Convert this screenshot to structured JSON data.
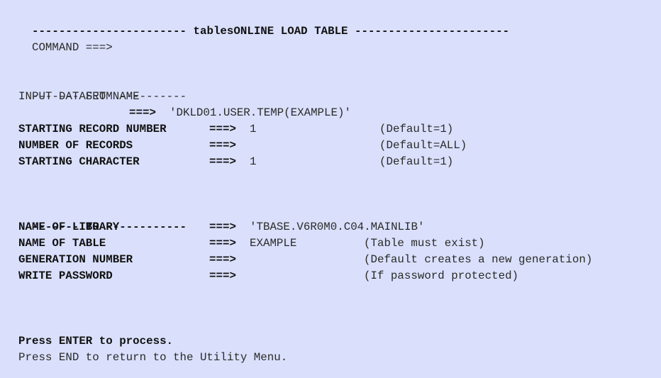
{
  "header": {
    "dashes_left": "-----------------------",
    "title": "tablesONLINE LOAD TABLE",
    "dashes_right": "-----------------------"
  },
  "command": {
    "label": "COMMAND ===>",
    "value": ""
  },
  "from_section": {
    "heading_left": "-------",
    "heading": "FROM",
    "heading_right": "----------",
    "input_dataset_label": "INPUT DATASET NAME",
    "input_dataset_arrow": "===>",
    "input_dataset_value": "'DKLD01.USER.TEMP(EXAMPLE)'",
    "fields": [
      {
        "label": "STARTING RECORD NUMBER",
        "arrow": "===>",
        "value": "1",
        "hint": "(Default=1)"
      },
      {
        "label": "NUMBER OF RECORDS",
        "arrow": "===>",
        "value": "",
        "hint": "(Default=ALL)"
      },
      {
        "label": "STARTING CHARACTER",
        "arrow": "===>",
        "value": "1",
        "hint": "(Default=1)"
      }
    ]
  },
  "to_section": {
    "heading_left": "-------",
    "heading": "TO",
    "heading_right": "------------",
    "fields": [
      {
        "label": "NAME OF LIBRARY",
        "arrow": "===>",
        "value": "'TBASE.V6R0M0.C04.MAINLIB'",
        "hint": ""
      },
      {
        "label": "NAME OF TABLE",
        "arrow": "===>",
        "value": "EXAMPLE",
        "hint": "(Table must exist)"
      },
      {
        "label": "GENERATION NUMBER",
        "arrow": "===>",
        "value": "",
        "hint": "(Default creates a new generation)"
      },
      {
        "label": "WRITE PASSWORD",
        "arrow": "===>",
        "value": "",
        "hint": "(If password protected)"
      }
    ]
  },
  "footer": {
    "enter_hint": "Press ENTER to process.",
    "end_hint": "Press END to return to the Utility Menu."
  }
}
